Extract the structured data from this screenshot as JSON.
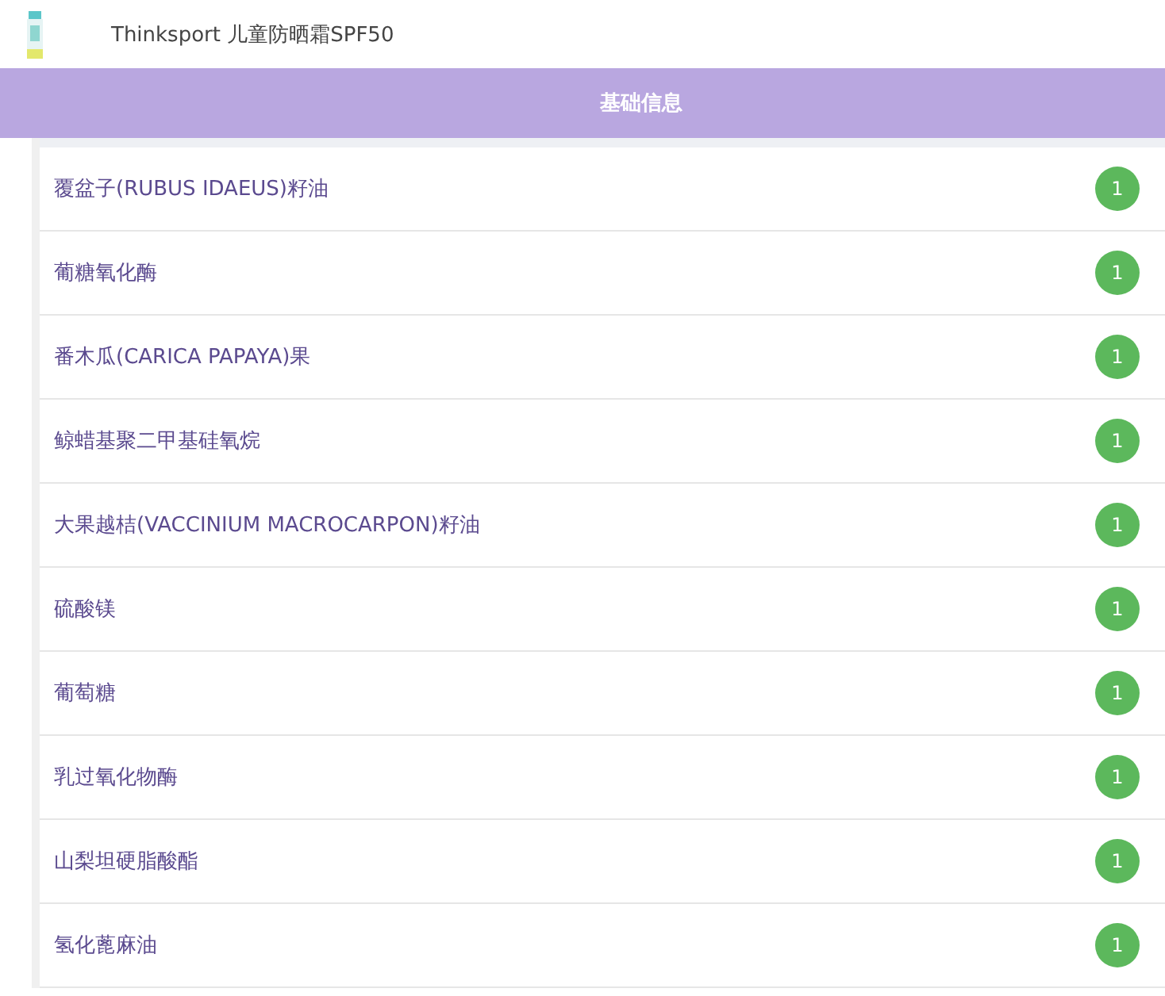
{
  "product": {
    "title": "Thinksport 儿童防晒霜SPF50"
  },
  "section": {
    "title": "基础信息"
  },
  "ingredients": [
    {
      "name": "覆盆子(RUBUS IDAEUS)籽油",
      "count": "1"
    },
    {
      "name": "葡糖氧化酶",
      "count": "1"
    },
    {
      "name": "番木瓜(CARICA PAPAYA)果",
      "count": "1"
    },
    {
      "name": "鲸蜡基聚二甲基硅氧烷",
      "count": "1"
    },
    {
      "name": "大果越桔(VACCINIUM MACROCARPON)籽油",
      "count": "1"
    },
    {
      "name": "硫酸镁",
      "count": "1"
    },
    {
      "name": "葡萄糖",
      "count": "1"
    },
    {
      "name": "乳过氧化物酶",
      "count": "1"
    },
    {
      "name": "山梨坦硬脂酸酯",
      "count": "1"
    },
    {
      "name": "氢化蓖麻油",
      "count": "1"
    }
  ]
}
